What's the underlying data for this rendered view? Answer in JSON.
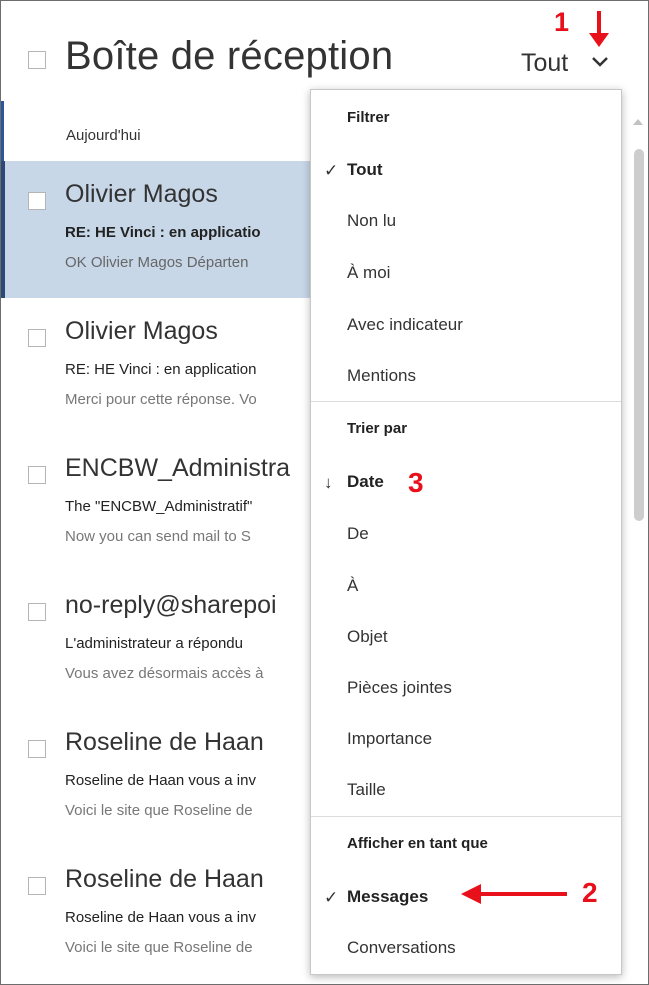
{
  "header": {
    "title": "Boîte de réception",
    "filter_label": "Tout",
    "chevron_icon": "chevron-down-icon"
  },
  "list": {
    "group_header": "Aujourd'hui",
    "messages": [
      {
        "sender": "Olivier Magos",
        "subject": "RE: HE Vinci : en applicatio",
        "preview": "OK  Olivier Magos Départen",
        "selected": true
      },
      {
        "sender": "Olivier Magos",
        "subject": "RE: HE Vinci : en application",
        "preview": "Merci pour cette réponse. Vo",
        "selected": false
      },
      {
        "sender": "ENCBW_Administra",
        "subject": "The \"ENCBW_Administratif\"",
        "preview": "Now you can send mail to S",
        "selected": false
      },
      {
        "sender": "no-reply@sharepoi",
        "subject": "L'administrateur a répondu",
        "preview": "Vous avez désormais accès à",
        "selected": false
      },
      {
        "sender": "Roseline de Haan",
        "subject": "Roseline de Haan vous a inv",
        "preview": "Voici le site que Roseline de",
        "selected": false
      },
      {
        "sender": "Roseline de Haan",
        "subject": "Roseline de Haan vous a inv",
        "preview": "Voici le site que Roseline de",
        "selected": false
      }
    ]
  },
  "menu": {
    "filter_title": "Filtrer",
    "filter_items": [
      "Tout",
      "Non lu",
      "À moi",
      "Avec indicateur",
      "Mentions"
    ],
    "sort_title": "Trier par",
    "sort_items": [
      "Date",
      "De",
      "À",
      "Objet",
      "Pièces jointes",
      "Importance",
      "Taille"
    ],
    "view_title": "Afficher en tant que",
    "view_items": [
      "Messages",
      "Conversations"
    ],
    "check_mark": "✓",
    "sort_arrow": "↓"
  },
  "annotations": {
    "one": "1",
    "two": "2",
    "three": "3",
    "color": "#e8101b"
  },
  "colors": {
    "selected_bg": "#c7d7e8",
    "selected_border": "#2b4a7a"
  }
}
